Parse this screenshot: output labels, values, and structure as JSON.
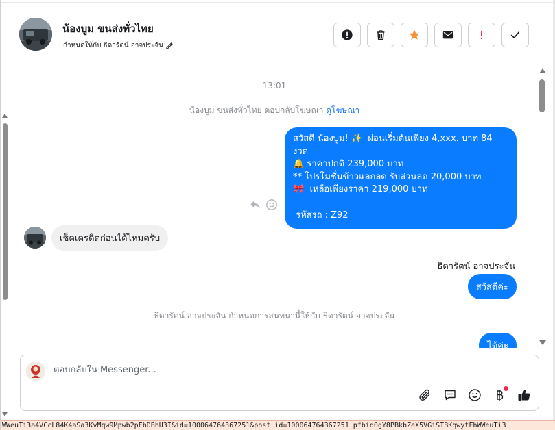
{
  "header": {
    "name": "น้องบูม ขนส่งทั่วไทย",
    "assigned": "กำหนดให้กับ ธิดารัตน์ อาจประจัน",
    "buttons": [
      {
        "icon": "alert-circle-icon"
      },
      {
        "icon": "trash-icon"
      },
      {
        "icon": "star-icon"
      },
      {
        "icon": "envelope-icon"
      },
      {
        "icon": "exclamation-icon"
      },
      {
        "icon": "check-icon"
      }
    ]
  },
  "conversation": {
    "timestamp": "13:01",
    "system_reply_prefix": "น้องบูม ขนส่งทั่วไทย ตอบกลับโฆษณา",
    "system_reply_link": "ดูโฆษณา",
    "outgoing_1": "สวัสดี น้องบูม! ✨  ผ่อนเริ่มต้นเพียง 4,xxx. บาท 84 งวด\n🔔 ราคาปกติ 239,000 บาท\n** โปรโมชั่นข้าวแลกลด รับส่วนลด 20,000 บาท\n🎀  เหลือเพียงราคา 219,000 บาท\n\n รหัสรถ : Z92",
    "incoming_1": "เช็คเครดิตก่อนได้ไหมครับ",
    "sender_name": "ธิดารัตน์ อาจประจัน",
    "outgoing_2": "สวัสดีค่ะ",
    "system_assign": "ธิดารัตน์ อาจประจัน กำหนดการสนทนานี้ให้กับ ธิดารัตน์ อาจประจัน",
    "outgoing_3": "ได้ค่ะ"
  },
  "composer": {
    "placeholder": "ตอบกลับใน Messenger...",
    "tools": [
      "paperclip-icon",
      "chat-template-icon",
      "emoji-icon",
      "baht-icon",
      "thumbs-up-icon"
    ]
  },
  "url_strip": "WWeuTi3a4VCcL84K4aSa3KvMqw9Mpwb2pFbDBbU3I&id=100064764367251&post_id=100064764367251_pfbid0gY8PBkbZeX5VGiSTBKqwytFbWWeuTi3"
}
